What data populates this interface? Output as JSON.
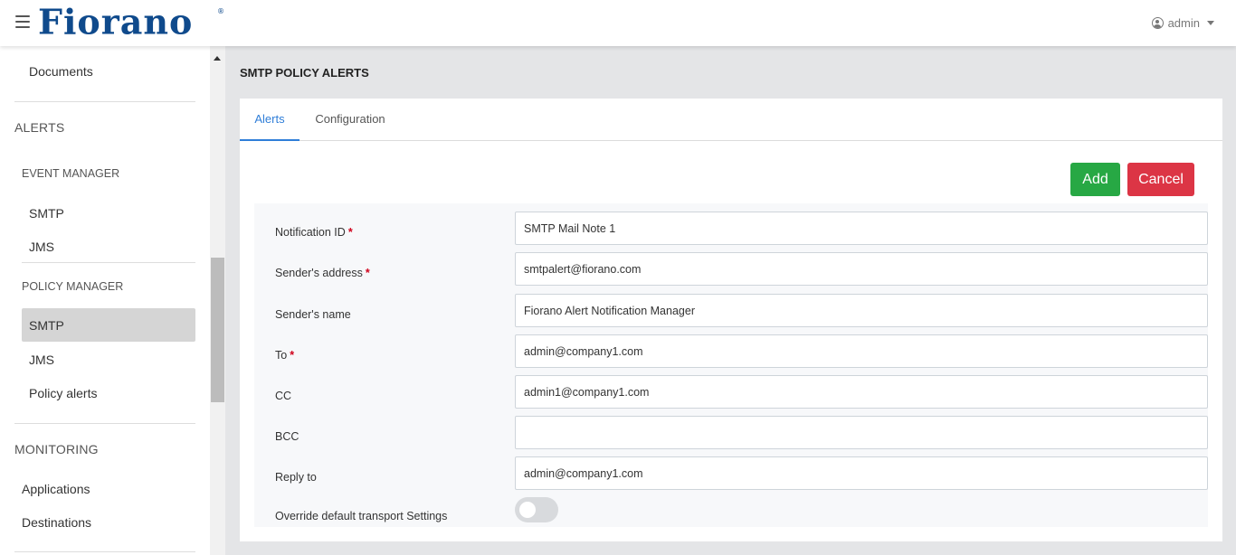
{
  "header": {
    "logo_text": "Fiorano",
    "logo_mark": "®",
    "user_label": "admin"
  },
  "sidebar": {
    "documents": "Documents",
    "alerts_section": "ALERTS",
    "event_manager": "EVENT MANAGER",
    "em_smtp": "SMTP",
    "em_jms": "JMS",
    "policy_manager": "POLICY MANAGER",
    "pm_smtp": "SMTP",
    "pm_jms": "JMS",
    "pm_policy_alerts": "Policy alerts",
    "monitoring_section": "MONITORING",
    "applications": "Applications",
    "destinations": "Destinations"
  },
  "main": {
    "title": "SMTP POLICY ALERTS",
    "tabs": [
      {
        "label": "Alerts",
        "active": true
      },
      {
        "label": "Configuration",
        "active": false
      }
    ],
    "add_label": "Add",
    "cancel_label": "Cancel"
  },
  "form": {
    "notification_id": {
      "label": "Notification ID",
      "value": "SMTP Mail Note 1",
      "required": true
    },
    "sender_address": {
      "label": "Sender's address",
      "value": "smtpalert@fiorano.com",
      "required": true
    },
    "sender_name": {
      "label": "Sender's name",
      "value": "Fiorano Alert Notification Manager",
      "required": false
    },
    "to": {
      "label": "To",
      "value": "admin@company1.com",
      "required": true
    },
    "cc": {
      "label": "CC",
      "value": "admin1@company1.com",
      "required": false
    },
    "bcc": {
      "label": "BCC",
      "value": "",
      "required": false
    },
    "reply_to": {
      "label": "Reply to",
      "value": "admin@company1.com",
      "required": false
    },
    "override": {
      "label": "Override default transport Settings",
      "enabled": false
    }
  },
  "required_marker": "*",
  "colors": {
    "brand": "#0f4a8c",
    "accent": "#2f7ed8",
    "add": "#27a844",
    "cancel": "#dc3545"
  }
}
